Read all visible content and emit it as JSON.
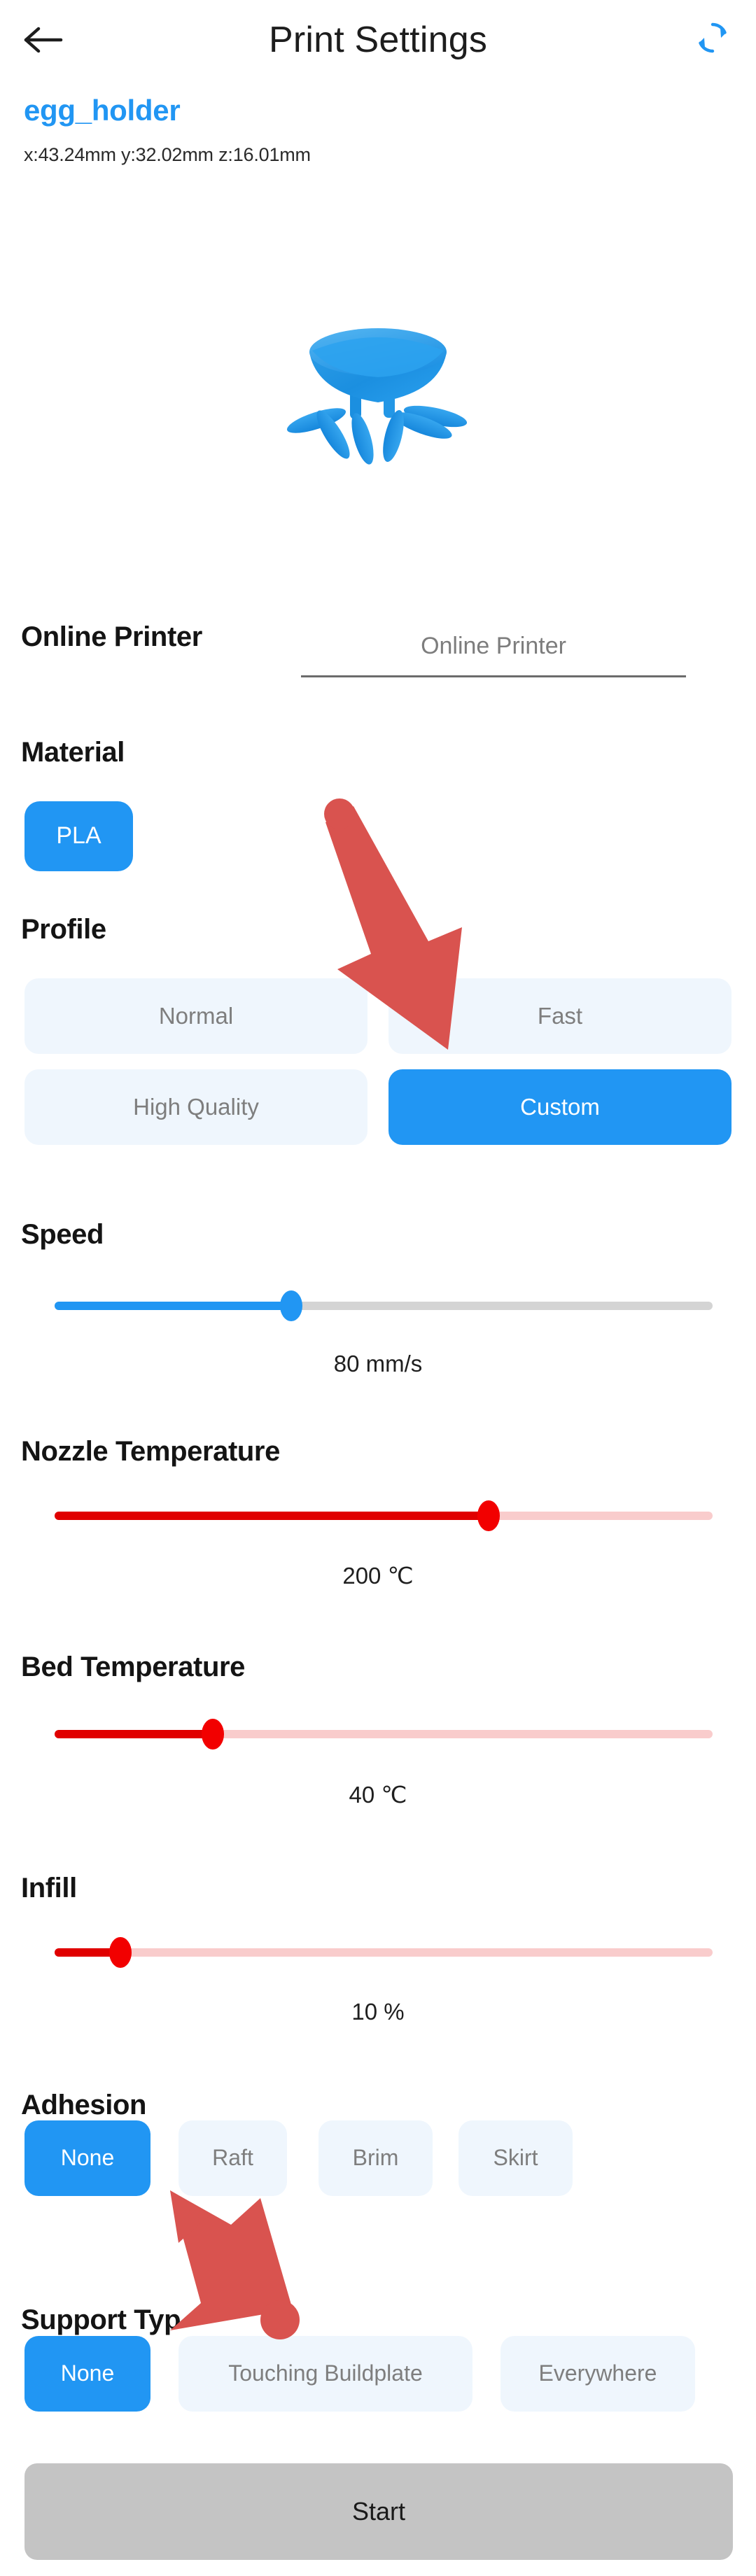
{
  "header": {
    "title": "Print Settings",
    "back_icon": "arrow-left-icon",
    "refresh_icon": "refresh-icon",
    "accent_color": "#2196f3"
  },
  "file": {
    "name": "egg_holder",
    "dimensions": "x:43.24mm y:32.02mm z:16.01mm"
  },
  "preview": {
    "model_name": "egg-holder-3d-model",
    "model_color": "#2196f3"
  },
  "printer": {
    "label": "Online Printer",
    "placeholder": "Online Printer",
    "value": ""
  },
  "material": {
    "label": "Material",
    "options": [
      {
        "label": "PLA",
        "selected": true
      }
    ]
  },
  "profile": {
    "label": "Profile",
    "options": [
      {
        "label": "Normal",
        "selected": false
      },
      {
        "label": "Fast",
        "selected": false
      },
      {
        "label": "High Quality",
        "selected": false
      },
      {
        "label": "Custom",
        "selected": true
      }
    ]
  },
  "speed": {
    "label": "Speed",
    "value_text": "80 mm/s",
    "value": 80,
    "unit": "mm/s",
    "fill_percent": 36,
    "color": "#2196f3"
  },
  "nozzle_temperature": {
    "label": "Nozzle Temperature",
    "value_text": "200 ℃",
    "value": 200,
    "unit": "℃",
    "fill_percent": 66,
    "color": "#e00000"
  },
  "bed_temperature": {
    "label": "Bed Temperature",
    "value_text": "40 ℃",
    "value": 40,
    "unit": "℃",
    "fill_percent": 24,
    "color": "#e00000"
  },
  "infill": {
    "label": "Infill",
    "value_text": "10 %",
    "value": 10,
    "unit": "%",
    "fill_percent": 10,
    "color": "#e00000"
  },
  "adhesion": {
    "label": "Adhesion",
    "options": [
      {
        "label": "None",
        "selected": true
      },
      {
        "label": "Raft",
        "selected": false
      },
      {
        "label": "Brim",
        "selected": false
      },
      {
        "label": "Skirt",
        "selected": false
      }
    ]
  },
  "support_type": {
    "label": "Support Typ",
    "options": [
      {
        "label": "None",
        "selected": true
      },
      {
        "label": "Touching Buildplate",
        "selected": false
      },
      {
        "label": "Everywhere",
        "selected": false
      }
    ]
  },
  "start": {
    "label": "Start",
    "enabled": false,
    "color": "#c4c4c4"
  },
  "annotations": {
    "arrow_color": "#d9534f",
    "arrows": [
      {
        "name": "arrow-to-profile-custom",
        "target": "Profile Custom / Fast area"
      },
      {
        "name": "arrow-to-adhesion-none",
        "target": "Adhesion None"
      }
    ]
  }
}
